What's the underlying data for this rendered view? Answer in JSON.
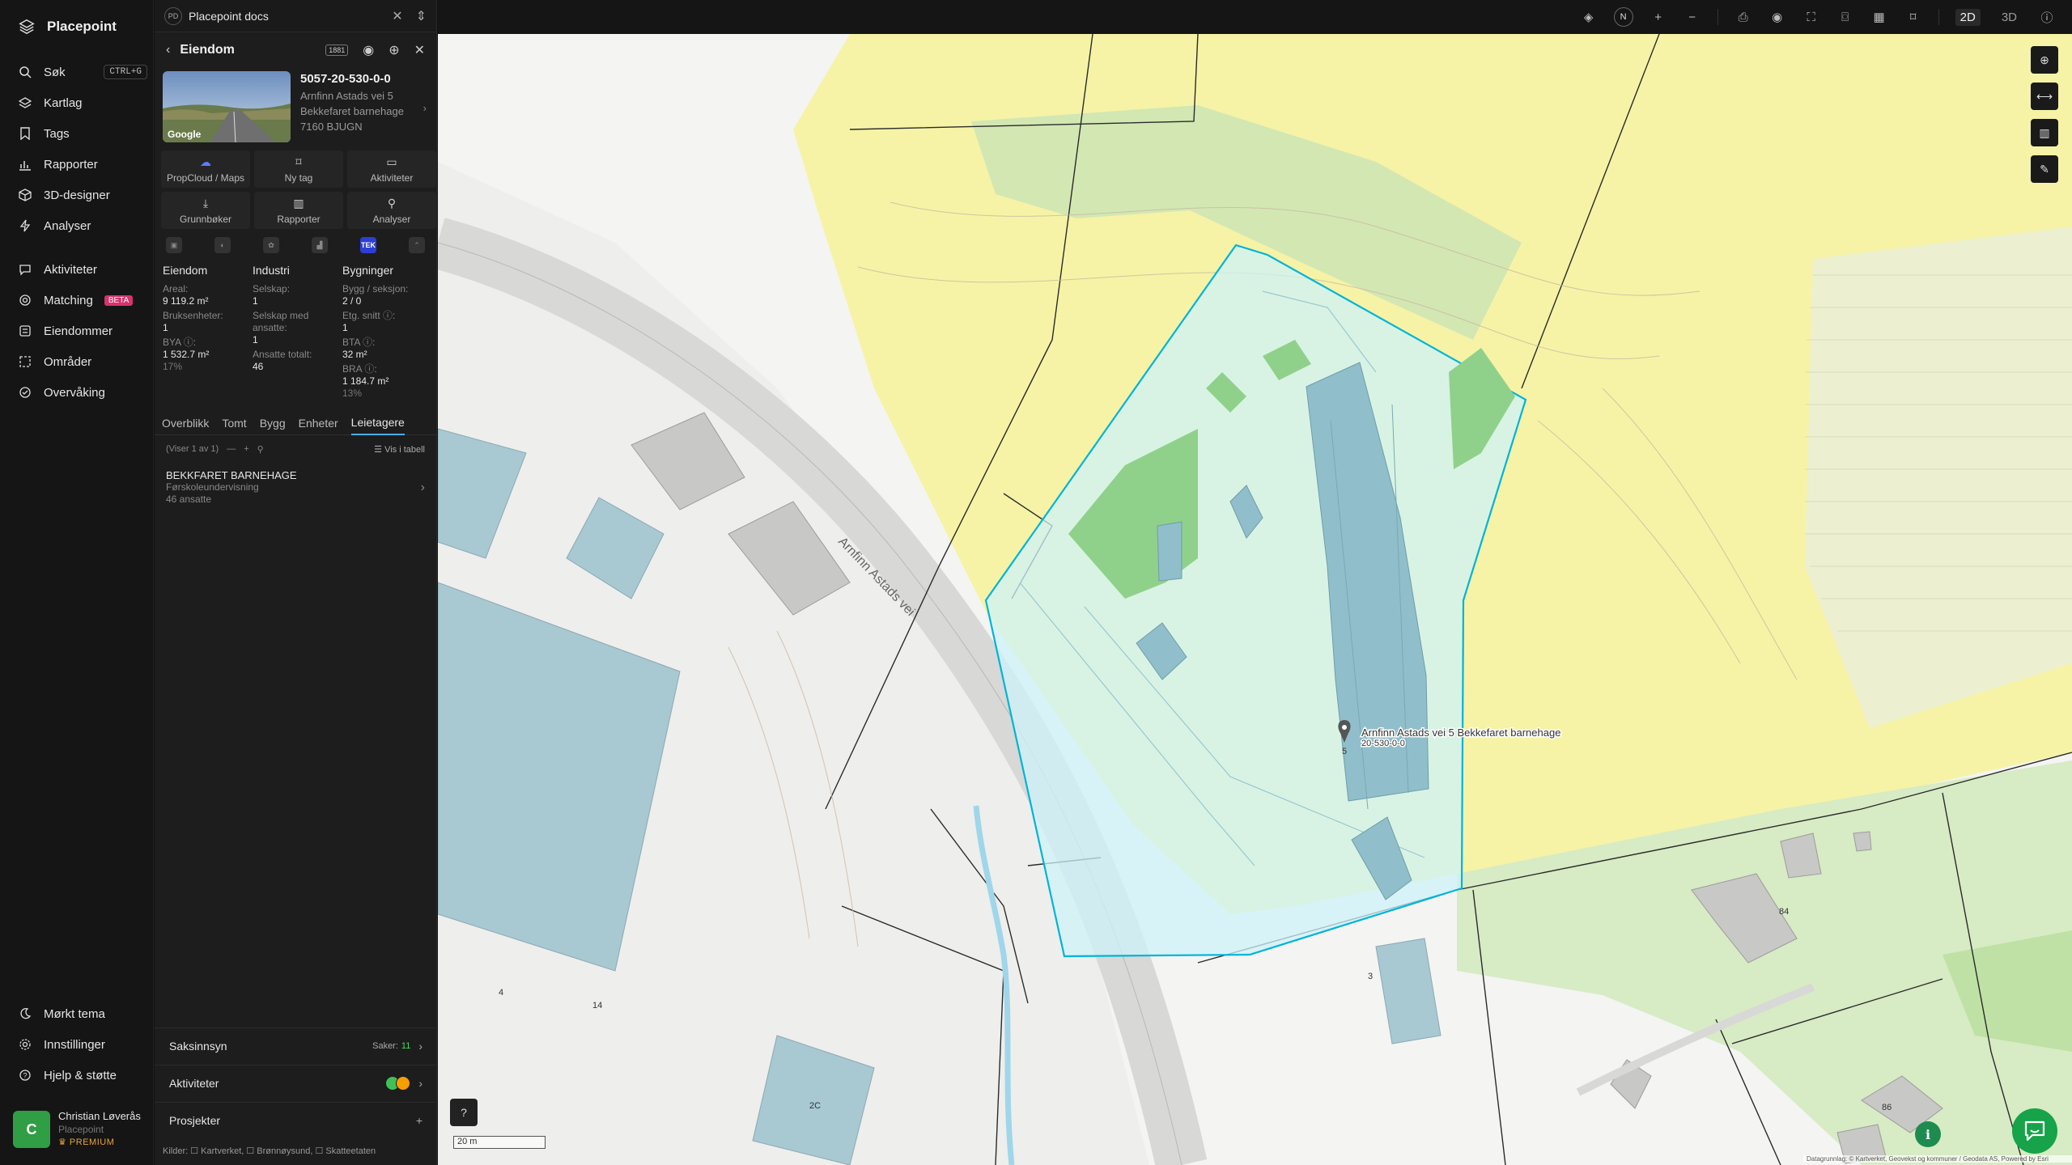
{
  "app": {
    "name": "Placepoint"
  },
  "nav": {
    "items": [
      {
        "label": "Søk",
        "shortcut": "CTRL+G"
      },
      {
        "label": "Kartlag"
      },
      {
        "label": "Tags"
      },
      {
        "label": "Rapporter"
      },
      {
        "label": "3D-designer"
      },
      {
        "label": "Analyser"
      },
      {
        "label": "Aktiviteter"
      },
      {
        "label": "Matching",
        "badge": "BETA"
      },
      {
        "label": "Eiendommer"
      },
      {
        "label": "Områder"
      },
      {
        "label": "Overvåking"
      }
    ],
    "bottom": [
      {
        "label": "Mørkt tema"
      },
      {
        "label": "Innstillinger"
      },
      {
        "label": "Hjelp & støtte"
      }
    ],
    "user": {
      "initial": "C",
      "name": "Christian Løverås",
      "org": "Placepoint",
      "plan": "PREMIUM"
    }
  },
  "doc": {
    "badge": "PD",
    "title": "Placepoint docs"
  },
  "property": {
    "header": "Eiendom",
    "header_badge": "1881",
    "id": "5057-20-530-0-0",
    "address": "Arnfinn Astads vei 5",
    "name": "Bekkefaret barnehage",
    "postal": "7160 BJUGN",
    "thumb_label": "Google",
    "actions": [
      {
        "label": "PropCloud / Maps",
        "icon": "cloud-icon"
      },
      {
        "label": "Ny tag",
        "icon": "bookmark-icon"
      },
      {
        "label": "Aktiviteter",
        "icon": "chat-icon"
      },
      {
        "label": "Grunnbøker",
        "icon": "download-icon"
      },
      {
        "label": "Rapporter",
        "icon": "chart-icon"
      },
      {
        "label": "Analyser",
        "icon": "pin-icon"
      }
    ],
    "source_badge": "TEK",
    "stats": {
      "eiendom": {
        "head": "Eiendom",
        "areal_label": "Areal:",
        "areal_val": "9 119.2 m²",
        "bruks_label": "Bruksenheter:",
        "bruks_val": "1",
        "bya_label": "BYA ⓘ:",
        "bya_val": "1 532.7 m²",
        "bya_pct": "17%"
      },
      "industri": {
        "head": "Industri",
        "selskap_label": "Selskap:",
        "selskap_val": "1",
        "ansatte_label": "Selskap med ansatte:",
        "ansatte_val": "1",
        "totalt_label": "Ansatte totalt:",
        "totalt_val": "46"
      },
      "bygninger": {
        "head": "Bygninger",
        "bygg_label": "Bygg / seksjon:",
        "bygg_val": "2 / 0",
        "etg_label": "Etg. snitt ⓘ:",
        "etg_val": "1",
        "bta_label": "BTA ⓘ:",
        "bta_val": "32 m²",
        "bra_label": "BRA ⓘ:",
        "bra_val": "1 184.7 m²",
        "bra_pct": "13%"
      }
    },
    "tabs": [
      "Overblikk",
      "Tomt",
      "Bygg",
      "Enheter",
      "Leietagere"
    ],
    "active_tab": "Leietagere",
    "list": {
      "showing": "(Viser 1 av 1)",
      "view_table": "Vis i tabell"
    },
    "tenants": [
      {
        "name": "BEKKFARET BARNEHAGE",
        "category": "Førskoleundervisning",
        "employees": "46 ansatte"
      }
    ],
    "accordions": {
      "saksinnsyn": {
        "label": "Saksinnsyn",
        "count_label": "Saker:",
        "count": "11"
      },
      "aktiviteter": {
        "label": "Aktiviteter"
      },
      "prosjekter": {
        "label": "Prosjekter"
      }
    },
    "sources": "Kilder: ☐ Kartverket, ☐ Brønnøysund, ☐ Skatteetaten"
  },
  "map": {
    "road_label": "Arnfinn Astads vei",
    "marker_label_1": "Arnfinn Astads vei 5 Bekkefaret barnehage",
    "marker_label_2": "20-530-0-0",
    "house_numbers": [
      "5",
      "3",
      "84",
      "86",
      "2C",
      "4",
      "14"
    ],
    "scale_label": "20 m",
    "attribution": "Datagrunnlag: © Kartverket, Geovekst og kommuner / Geodata AS, Powered by Esri",
    "modes": [
      "2D",
      "3D"
    ],
    "active_mode": "2D",
    "compass": "N",
    "colors": {
      "parcel": "#00b4d8",
      "park": "#8fd18a",
      "farmland": "#f6f3a6",
      "building": "#a8c8d2"
    }
  }
}
